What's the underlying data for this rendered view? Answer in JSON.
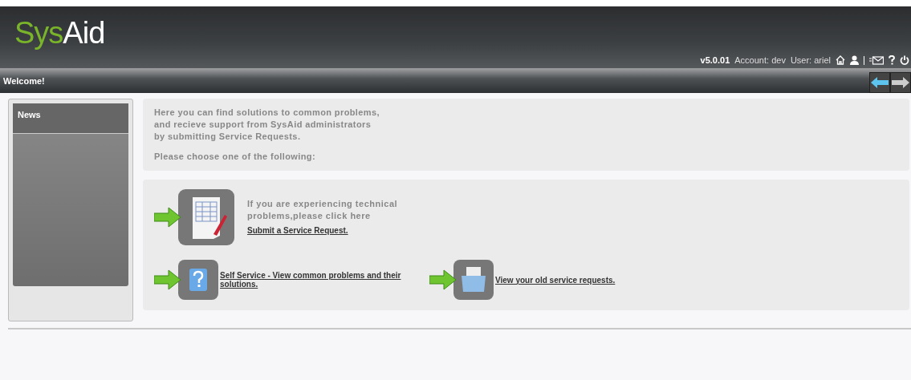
{
  "logo": {
    "first": "Sys",
    "second": "Aid"
  },
  "header_info": {
    "version": "v5.0.01",
    "account": "Account: dev",
    "user": "User: ariel"
  },
  "title_bar": {
    "title": "Welcome!"
  },
  "sidebar": {
    "title": "News"
  },
  "intro": {
    "lines": [
      "Here you can find solutions to common problems,",
      "and recieve support from SysAid administrators",
      "by submitting Service Requests."
    ],
    "prompt": "Please choose one of the following:"
  },
  "options": [
    {
      "kind": "submit",
      "lines": [
        "If you are experiencing technical",
        "problems,please click here"
      ],
      "link": "Submit a Service Request."
    },
    {
      "kind": "self_service",
      "link": "Self Service - View common problems and their solutions."
    },
    {
      "kind": "history",
      "link": "View your old service requests."
    }
  ]
}
